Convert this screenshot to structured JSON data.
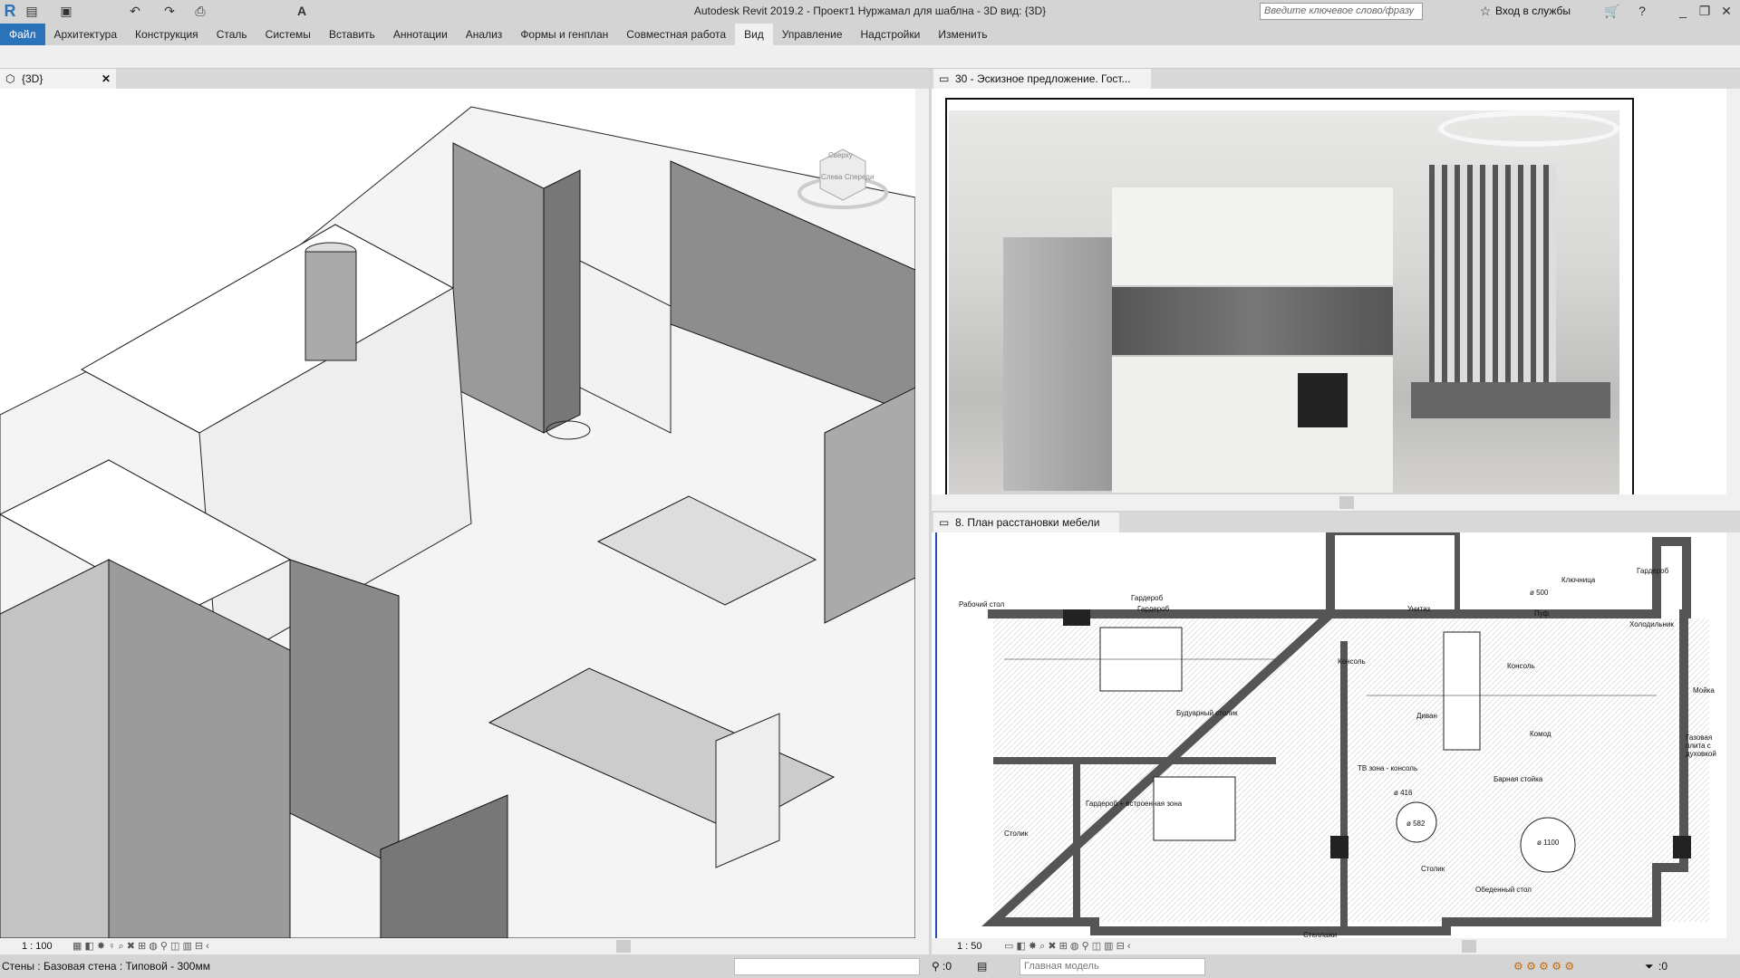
{
  "app": {
    "title": "Autodesk Revit 2019.2 - Проект1 Нуржамал для шаблна - 3D вид: {3D}",
    "search_placeholder": "Введите ключевое слово/фразу",
    "sign_in": "Вход в службы"
  },
  "ribbon": {
    "tabs": [
      "Файл",
      "Архитектура",
      "Конструкция",
      "Сталь",
      "Системы",
      "Вставить",
      "Аннотации",
      "Анализ",
      "Формы и генплан",
      "Совместная работа",
      "Вид",
      "Управление",
      "Надстройки",
      "Изменить"
    ],
    "active": "Вид"
  },
  "views": {
    "left": {
      "tab": "{3D}",
      "scale": "1 : 100",
      "viewcube": [
        "Сверху",
        "Слева",
        "Спереди"
      ]
    },
    "right_top": {
      "tab": "30 - Эскизное предложение. Гост..."
    },
    "right_bottom": {
      "tab": "8. План расстановки мебели",
      "scale": "1 : 50",
      "labels": [
        "Рабочий стол",
        "Гардероб",
        "Гардероб",
        "Будуарный столик",
        "Гардероб + встроенная зона",
        "Столик",
        "ТВ зона - консоль",
        "Диван",
        "Комод",
        "Барная стойка",
        "Столик",
        "Обеденный стол",
        "Консоль",
        "Консоль",
        "Унитаз",
        "Пуф",
        "Ключница",
        "Гардероб",
        "Холодильник",
        "Мойка",
        "Газовая плита с духовкой",
        "Стеллажи",
        "ø 1100",
        "ø 416",
        "ø 582",
        "ø 500"
      ]
    }
  },
  "status": {
    "text": "Стены : Базовая стена : Типовой - 300мм",
    "workset_count": ":0",
    "model": "Главная модель",
    "filter_count": ":0"
  }
}
